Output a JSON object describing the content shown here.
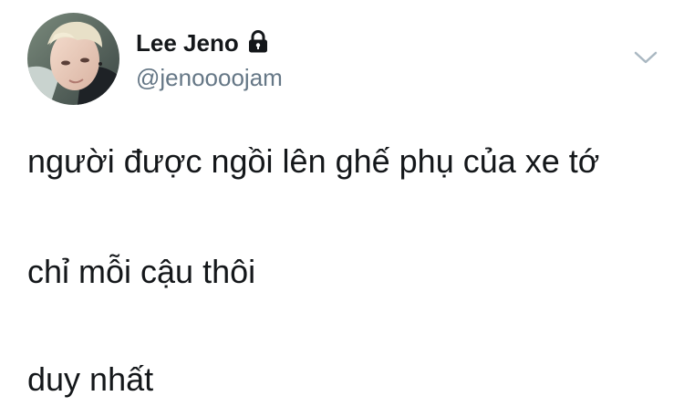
{
  "tweet": {
    "author": {
      "display_name": "Lee Jeno",
      "handle": "@jenoooojam",
      "protected_icon": "lock-icon",
      "avatar": "profile-photo"
    },
    "menu_icon": "chevron-down-icon",
    "lines": [
      "người được ngồi lên ghế phụ của xe tớ",
      "chỉ mỗi cậu thôi",
      "duy nhất"
    ]
  },
  "colors": {
    "text": "#14171a",
    "secondary_text": "#657786",
    "chevron": "#aab8c2",
    "background": "#ffffff"
  }
}
